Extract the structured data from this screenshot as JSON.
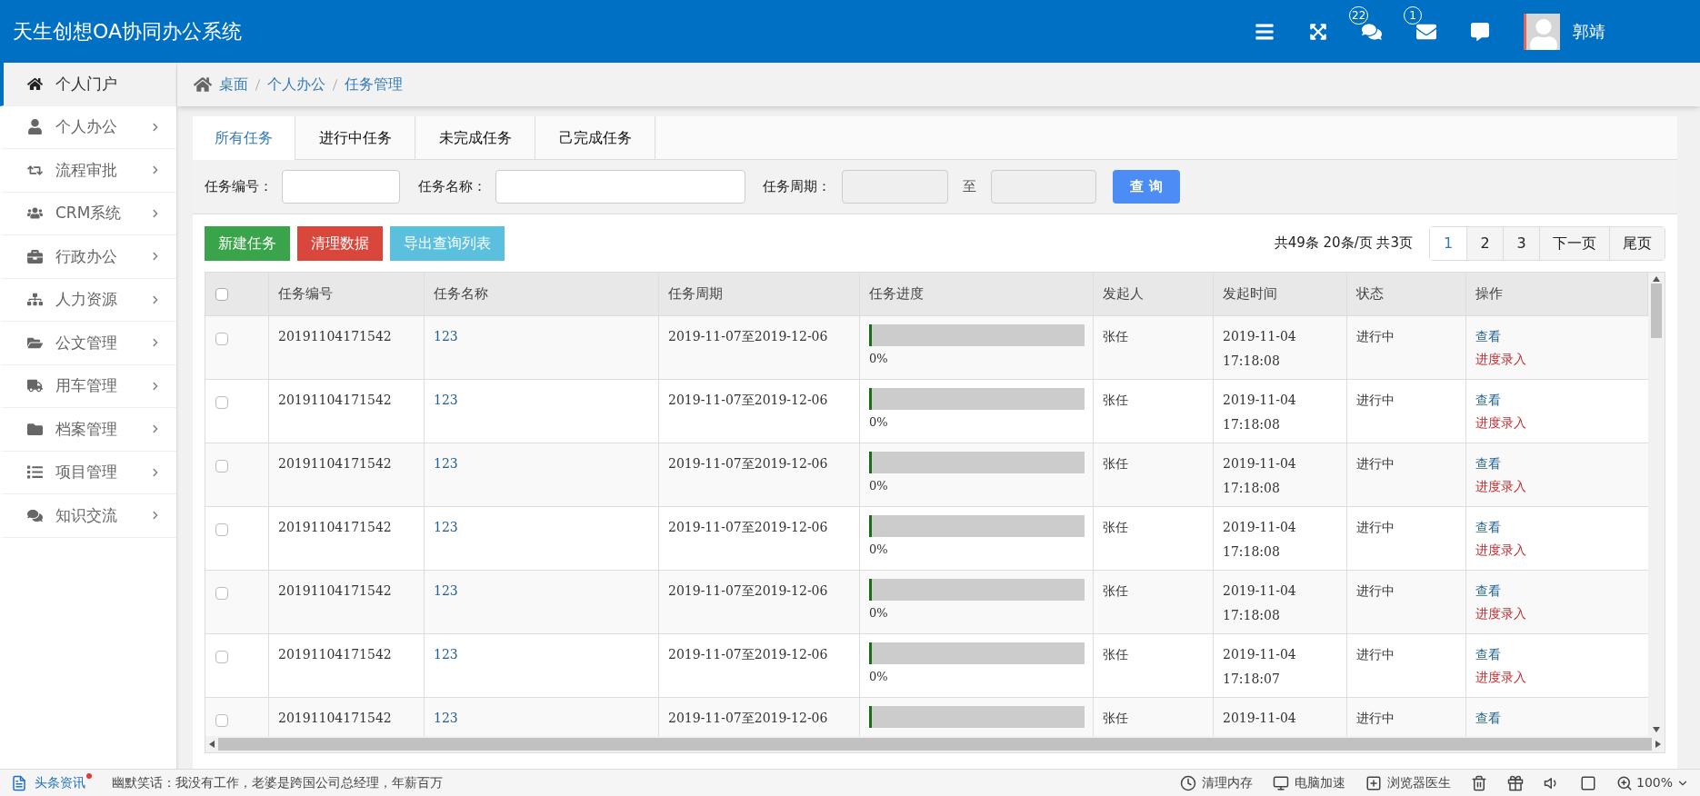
{
  "header": {
    "title": "天生创想OA协同办公系统",
    "badges": [
      {
        "kind": "chat",
        "count": "22"
      },
      {
        "kind": "mail",
        "count": "1"
      }
    ],
    "user": "郭靖"
  },
  "sidebar": {
    "items": [
      {
        "label": "个人门户",
        "kind": "home",
        "selected": true,
        "submenu": false
      },
      {
        "label": "个人办公",
        "kind": "user",
        "selected": false,
        "submenu": true
      },
      {
        "label": "流程审批",
        "kind": "retweet",
        "selected": false,
        "submenu": true
      },
      {
        "label": "CRM系统",
        "kind": "users",
        "selected": false,
        "submenu": true
      },
      {
        "label": "行政办公",
        "kind": "briefcase",
        "selected": false,
        "submenu": true
      },
      {
        "label": "人力资源",
        "kind": "sitemap",
        "selected": false,
        "submenu": true
      },
      {
        "label": "公文管理",
        "kind": "folder-open",
        "selected": false,
        "submenu": true
      },
      {
        "label": "用车管理",
        "kind": "truck",
        "selected": false,
        "submenu": true
      },
      {
        "label": "档案管理",
        "kind": "folder",
        "selected": false,
        "submenu": true
      },
      {
        "label": "项目管理",
        "kind": "list",
        "selected": false,
        "submenu": true
      },
      {
        "label": "知识交流",
        "kind": "comments",
        "selected": false,
        "submenu": true
      }
    ]
  },
  "breadcrumb": [
    "桌面",
    "个人办公",
    "任务管理"
  ],
  "tabs": [
    {
      "label": "所有任务",
      "selected": true
    },
    {
      "label": "进行中任务",
      "selected": false
    },
    {
      "label": "未完成任务",
      "selected": false
    },
    {
      "label": "己完成任务",
      "selected": false
    }
  ],
  "search": {
    "id_label": "任务编号：",
    "name_label": "任务名称：",
    "period_label": "任务周期：",
    "to": "至",
    "button": "查 询"
  },
  "actions": [
    {
      "label": "新建任务",
      "kind": "success"
    },
    {
      "label": "清理数据",
      "kind": "danger"
    },
    {
      "label": "导出查询列表",
      "kind": "info"
    }
  ],
  "pagination": {
    "summary": "共49条 20条/页 共3页",
    "pages": [
      {
        "label": "1",
        "selected": true
      },
      {
        "label": "2",
        "selected": false
      },
      {
        "label": "3",
        "selected": false
      },
      {
        "label": "下一页",
        "selected": false
      },
      {
        "label": "尾页",
        "selected": false
      }
    ]
  },
  "table": {
    "select_all": {
      "checked": false
    },
    "columns": [
      "任务编号",
      "任务名称",
      "任务周期",
      "任务进度",
      "发起人",
      "发起时间",
      "状态",
      "操作"
    ],
    "rows": [
      {
        "checked": false,
        "id": "20191104171542",
        "name": "123",
        "period": "2019-11-07至2019-12-06",
        "level": 0,
        "progress": "0%",
        "initiator": "张任",
        "date": "2019-11-04",
        "time": "17:18:08",
        "status": "进行中",
        "view": "查看",
        "entry": "进度录入"
      },
      {
        "checked": false,
        "id": "20191104171542",
        "name": "123",
        "period": "2019-11-07至2019-12-06",
        "level": 0,
        "progress": "0%",
        "initiator": "张任",
        "date": "2019-11-04",
        "time": "17:18:08",
        "status": "进行中",
        "view": "查看",
        "entry": "进度录入"
      },
      {
        "checked": false,
        "id": "20191104171542",
        "name": "123",
        "period": "2019-11-07至2019-12-06",
        "level": 0,
        "progress": "0%",
        "initiator": "张任",
        "date": "2019-11-04",
        "time": "17:18:08",
        "status": "进行中",
        "view": "查看",
        "entry": "进度录入"
      },
      {
        "checked": false,
        "id": "20191104171542",
        "name": "123",
        "period": "2019-11-07至2019-12-06",
        "level": 0,
        "progress": "0%",
        "initiator": "张任",
        "date": "2019-11-04",
        "time": "17:18:08",
        "status": "进行中",
        "view": "查看",
        "entry": "进度录入"
      },
      {
        "checked": false,
        "id": "20191104171542",
        "name": "123",
        "period": "2019-11-07至2019-12-06",
        "level": 0,
        "progress": "0%",
        "initiator": "张任",
        "date": "2019-11-04",
        "time": "17:18:08",
        "status": "进行中",
        "view": "查看",
        "entry": "进度录入"
      },
      {
        "checked": false,
        "id": "20191104171542",
        "name": "123",
        "period": "2019-11-07至2019-12-06",
        "level": 0,
        "progress": "0%",
        "initiator": "张任",
        "date": "2019-11-04",
        "time": "17:18:07",
        "status": "进行中",
        "view": "查看",
        "entry": "进度录入"
      },
      {
        "checked": false,
        "id": "20191104171542",
        "name": "123",
        "period": "2019-11-07至2019-12-06",
        "level": 0,
        "initiator": "张任",
        "date": "2019-11-04",
        "status": "进行中",
        "view": "查看"
      }
    ]
  },
  "status_bar": {
    "news": "头条资讯",
    "joke": "幽默笑话：我没有工作，老婆是跨国公司总经理，年薪百万",
    "tools": [
      {
        "kind": "memory",
        "label": "清理内存"
      },
      {
        "kind": "speed",
        "label": "电脑加速"
      },
      {
        "kind": "doctor",
        "label": "浏览器医生"
      }
    ],
    "zoom": "100%"
  }
}
